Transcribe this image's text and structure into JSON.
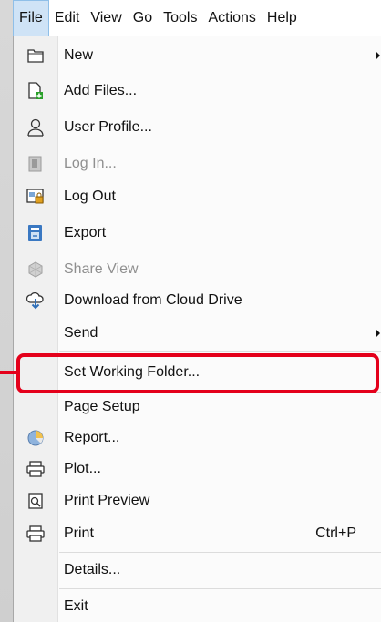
{
  "menubar": {
    "items": [
      "File",
      "Edit",
      "View",
      "Go",
      "Tools",
      "Actions",
      "Help"
    ],
    "active": "File"
  },
  "file_menu": {
    "items": [
      {
        "label": "New",
        "icon": "folder-icon",
        "submenu": true
      },
      {
        "label": "Add Files...",
        "icon": "add-file-icon"
      },
      {
        "label": "User Profile...",
        "icon": "user-icon"
      },
      {
        "label": "Log In...",
        "icon": "log-in-icon",
        "disabled": true
      },
      {
        "label": "Log Out",
        "icon": "log-out-icon"
      },
      {
        "label": "Export",
        "icon": "export-icon"
      },
      {
        "label": "Share View",
        "icon": "share-view-icon",
        "disabled": true
      },
      {
        "label": "Download from Cloud Drive",
        "icon": "cloud-download-icon"
      },
      {
        "label": "Send",
        "submenu": true
      },
      {
        "label": "Set Working Folder...",
        "highlighted": true
      },
      {
        "label": "Page Setup"
      },
      {
        "label": "Report...",
        "icon": "report-chart-icon"
      },
      {
        "label": "Plot...",
        "icon": "plot-printer-icon"
      },
      {
        "label": "Print Preview",
        "icon": "print-preview-icon"
      },
      {
        "label": "Print",
        "icon": "printer-icon",
        "shortcut": "Ctrl+P"
      },
      {
        "label": "Details..."
      },
      {
        "label": "Exit"
      }
    ]
  },
  "colors": {
    "highlight": "#e4001b",
    "menu_active_bg": "#cfe3f6",
    "disabled_text": "#8f8f8f"
  }
}
